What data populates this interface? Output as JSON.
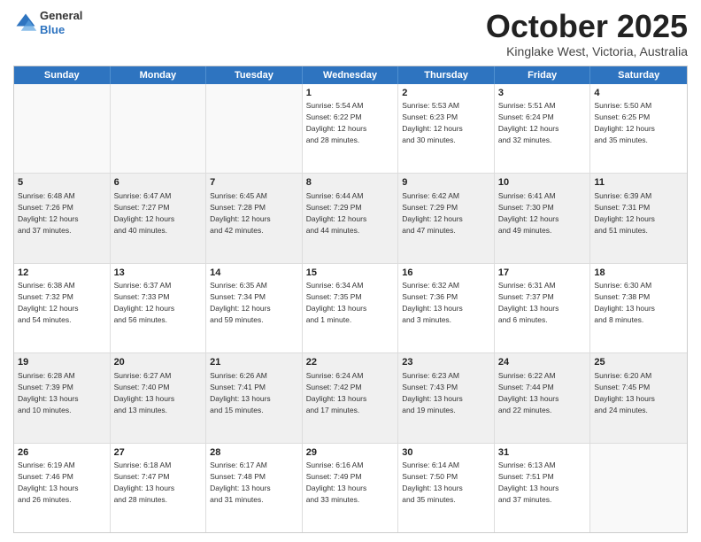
{
  "header": {
    "logo_general": "General",
    "logo_blue": "Blue",
    "month": "October 2025",
    "location": "Kinglake West, Victoria, Australia"
  },
  "days": [
    "Sunday",
    "Monday",
    "Tuesday",
    "Wednesday",
    "Thursday",
    "Friday",
    "Saturday"
  ],
  "rows": [
    [
      {
        "day": "",
        "text": ""
      },
      {
        "day": "",
        "text": ""
      },
      {
        "day": "",
        "text": ""
      },
      {
        "day": "1",
        "text": "Sunrise: 5:54 AM\nSunset: 6:22 PM\nDaylight: 12 hours\nand 28 minutes."
      },
      {
        "day": "2",
        "text": "Sunrise: 5:53 AM\nSunset: 6:23 PM\nDaylight: 12 hours\nand 30 minutes."
      },
      {
        "day": "3",
        "text": "Sunrise: 5:51 AM\nSunset: 6:24 PM\nDaylight: 12 hours\nand 32 minutes."
      },
      {
        "day": "4",
        "text": "Sunrise: 5:50 AM\nSunset: 6:25 PM\nDaylight: 12 hours\nand 35 minutes."
      }
    ],
    [
      {
        "day": "5",
        "text": "Sunrise: 6:48 AM\nSunset: 7:26 PM\nDaylight: 12 hours\nand 37 minutes."
      },
      {
        "day": "6",
        "text": "Sunrise: 6:47 AM\nSunset: 7:27 PM\nDaylight: 12 hours\nand 40 minutes."
      },
      {
        "day": "7",
        "text": "Sunrise: 6:45 AM\nSunset: 7:28 PM\nDaylight: 12 hours\nand 42 minutes."
      },
      {
        "day": "8",
        "text": "Sunrise: 6:44 AM\nSunset: 7:29 PM\nDaylight: 12 hours\nand 44 minutes."
      },
      {
        "day": "9",
        "text": "Sunrise: 6:42 AM\nSunset: 7:29 PM\nDaylight: 12 hours\nand 47 minutes."
      },
      {
        "day": "10",
        "text": "Sunrise: 6:41 AM\nSunset: 7:30 PM\nDaylight: 12 hours\nand 49 minutes."
      },
      {
        "day": "11",
        "text": "Sunrise: 6:39 AM\nSunset: 7:31 PM\nDaylight: 12 hours\nand 51 minutes."
      }
    ],
    [
      {
        "day": "12",
        "text": "Sunrise: 6:38 AM\nSunset: 7:32 PM\nDaylight: 12 hours\nand 54 minutes."
      },
      {
        "day": "13",
        "text": "Sunrise: 6:37 AM\nSunset: 7:33 PM\nDaylight: 12 hours\nand 56 minutes."
      },
      {
        "day": "14",
        "text": "Sunrise: 6:35 AM\nSunset: 7:34 PM\nDaylight: 12 hours\nand 59 minutes."
      },
      {
        "day": "15",
        "text": "Sunrise: 6:34 AM\nSunset: 7:35 PM\nDaylight: 13 hours\nand 1 minute."
      },
      {
        "day": "16",
        "text": "Sunrise: 6:32 AM\nSunset: 7:36 PM\nDaylight: 13 hours\nand 3 minutes."
      },
      {
        "day": "17",
        "text": "Sunrise: 6:31 AM\nSunset: 7:37 PM\nDaylight: 13 hours\nand 6 minutes."
      },
      {
        "day": "18",
        "text": "Sunrise: 6:30 AM\nSunset: 7:38 PM\nDaylight: 13 hours\nand 8 minutes."
      }
    ],
    [
      {
        "day": "19",
        "text": "Sunrise: 6:28 AM\nSunset: 7:39 PM\nDaylight: 13 hours\nand 10 minutes."
      },
      {
        "day": "20",
        "text": "Sunrise: 6:27 AM\nSunset: 7:40 PM\nDaylight: 13 hours\nand 13 minutes."
      },
      {
        "day": "21",
        "text": "Sunrise: 6:26 AM\nSunset: 7:41 PM\nDaylight: 13 hours\nand 15 minutes."
      },
      {
        "day": "22",
        "text": "Sunrise: 6:24 AM\nSunset: 7:42 PM\nDaylight: 13 hours\nand 17 minutes."
      },
      {
        "day": "23",
        "text": "Sunrise: 6:23 AM\nSunset: 7:43 PM\nDaylight: 13 hours\nand 19 minutes."
      },
      {
        "day": "24",
        "text": "Sunrise: 6:22 AM\nSunset: 7:44 PM\nDaylight: 13 hours\nand 22 minutes."
      },
      {
        "day": "25",
        "text": "Sunrise: 6:20 AM\nSunset: 7:45 PM\nDaylight: 13 hours\nand 24 minutes."
      }
    ],
    [
      {
        "day": "26",
        "text": "Sunrise: 6:19 AM\nSunset: 7:46 PM\nDaylight: 13 hours\nand 26 minutes."
      },
      {
        "day": "27",
        "text": "Sunrise: 6:18 AM\nSunset: 7:47 PM\nDaylight: 13 hours\nand 28 minutes."
      },
      {
        "day": "28",
        "text": "Sunrise: 6:17 AM\nSunset: 7:48 PM\nDaylight: 13 hours\nand 31 minutes."
      },
      {
        "day": "29",
        "text": "Sunrise: 6:16 AM\nSunset: 7:49 PM\nDaylight: 13 hours\nand 33 minutes."
      },
      {
        "day": "30",
        "text": "Sunrise: 6:14 AM\nSunset: 7:50 PM\nDaylight: 13 hours\nand 35 minutes."
      },
      {
        "day": "31",
        "text": "Sunrise: 6:13 AM\nSunset: 7:51 PM\nDaylight: 13 hours\nand 37 minutes."
      },
      {
        "day": "",
        "text": ""
      }
    ]
  ]
}
